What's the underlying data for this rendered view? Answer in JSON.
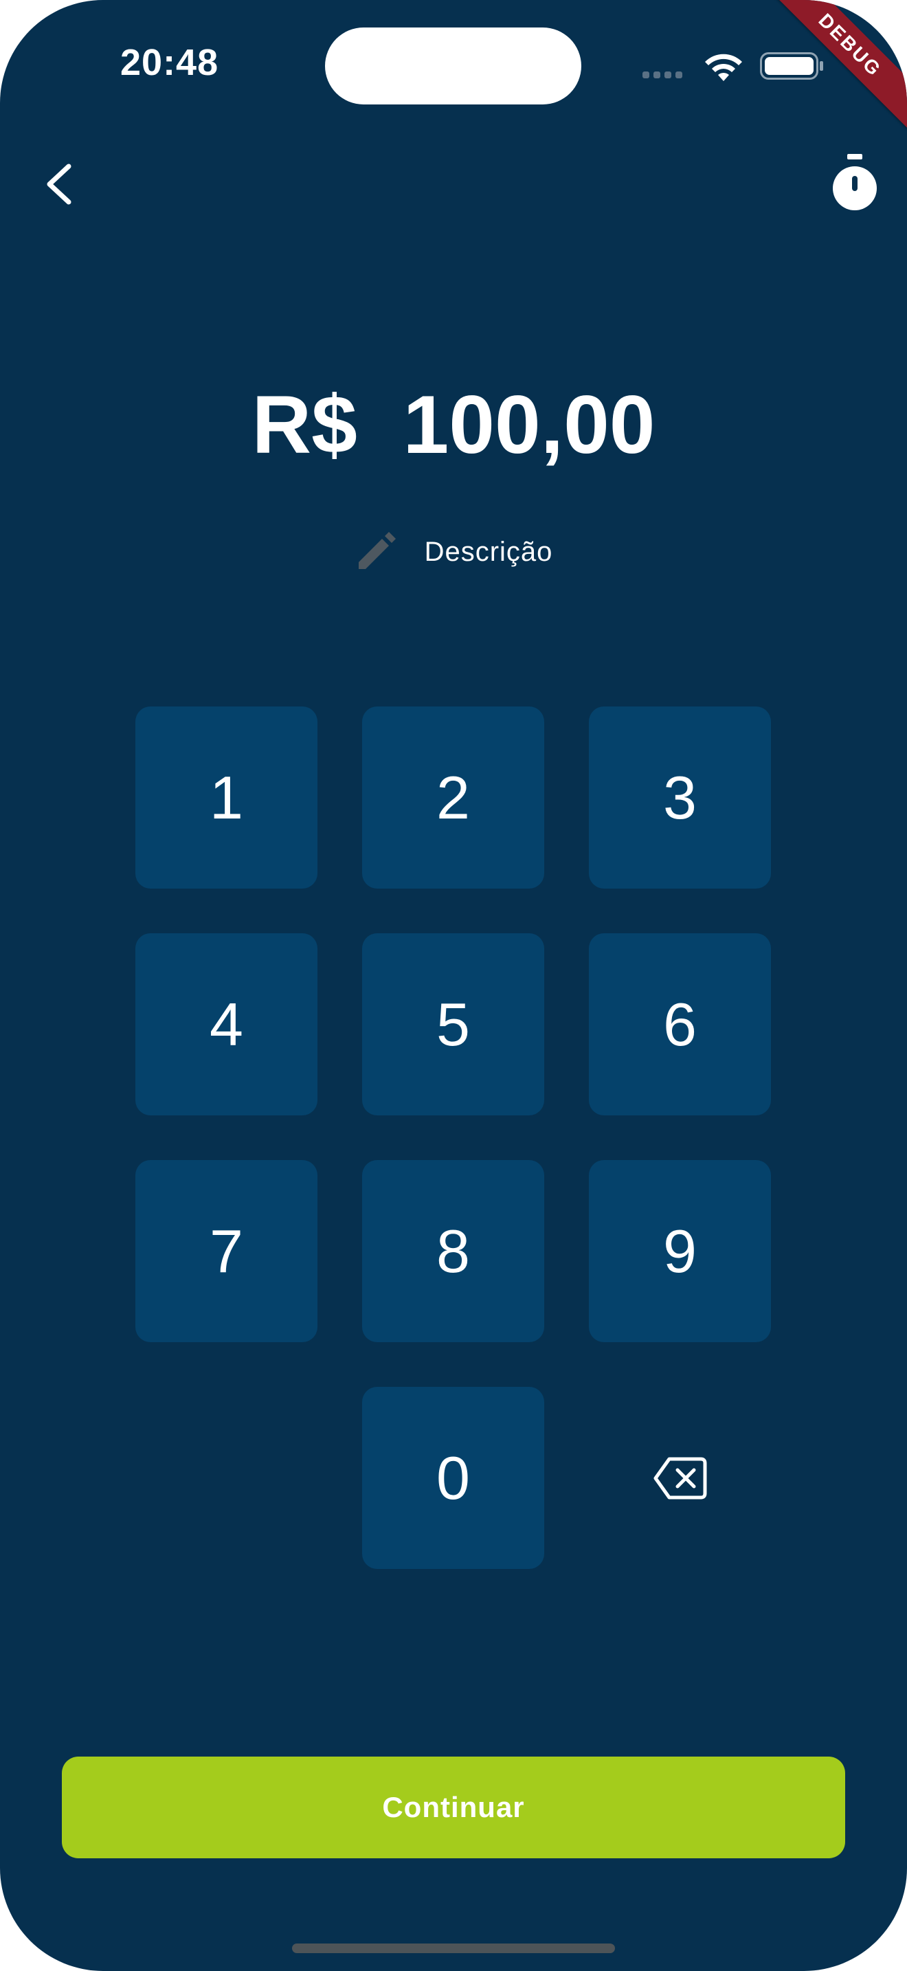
{
  "status_bar": {
    "time": "20:48"
  },
  "debug_banner": "DEBUG",
  "icons": {
    "back": "chevron-left-icon",
    "timer": "stopwatch-icon",
    "description": "pencil-icon",
    "backspace": "backspace-icon",
    "wifi": "wifi-icon",
    "battery": "battery-icon"
  },
  "amount": {
    "text": "R$  100,00"
  },
  "description": {
    "label": "Descrição"
  },
  "keypad": {
    "keys": [
      "1",
      "2",
      "3",
      "4",
      "5",
      "6",
      "7",
      "8",
      "9",
      "0"
    ]
  },
  "continue_button": {
    "label": "Continuar"
  },
  "colors": {
    "background": "#06304f",
    "key_background": "#05426b",
    "accent": "#a4cc1c",
    "debug_ribbon": "#8e1b28"
  }
}
